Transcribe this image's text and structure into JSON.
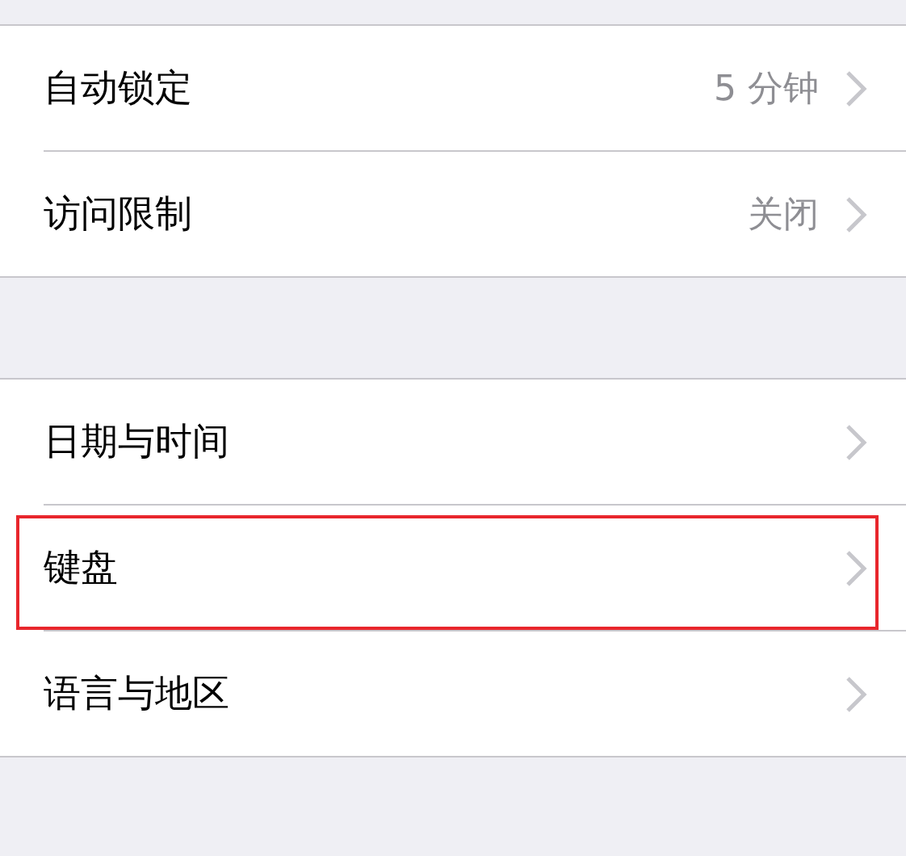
{
  "groups": [
    {
      "rows": [
        {
          "label": "自动锁定",
          "value": "5 分钟",
          "highlighted": false
        },
        {
          "label": "访问限制",
          "value": "关闭",
          "highlighted": false
        }
      ]
    },
    {
      "rows": [
        {
          "label": "日期与时间",
          "highlighted": false
        },
        {
          "label": "键盘",
          "highlighted": true
        },
        {
          "label": "语言与地区",
          "highlighted": false
        }
      ]
    }
  ]
}
